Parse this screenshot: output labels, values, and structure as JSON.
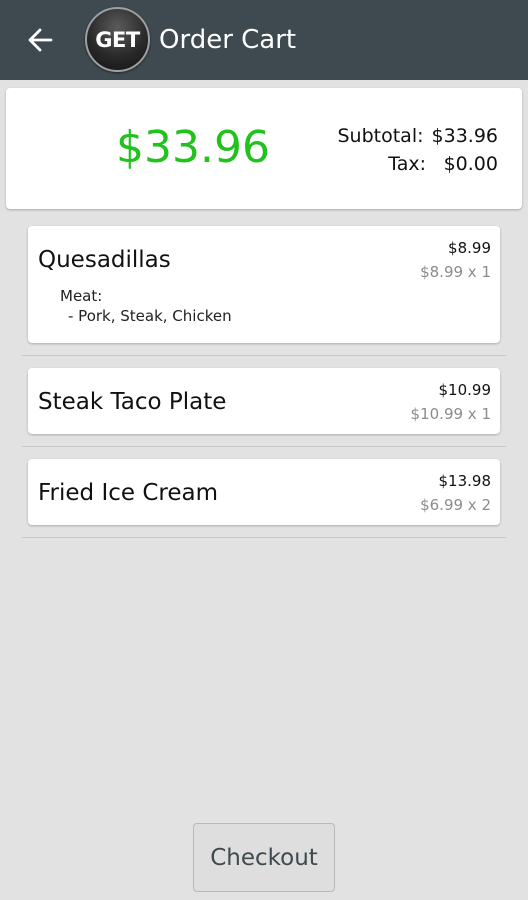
{
  "appbar": {
    "back_icon": "arrow-left-icon",
    "logo_text": "GET",
    "title": "Order Cart"
  },
  "summary": {
    "total": "$33.96",
    "subtotal_label": "Subtotal:",
    "subtotal_value": "$33.96",
    "tax_label": "Tax:",
    "tax_value": "$0.00",
    "total_color": "#22c21e"
  },
  "items": [
    {
      "name": "Quesadillas",
      "price": "$8.99",
      "unit": "$8.99 x 1",
      "modifier_label": "Meat:",
      "modifier_value": "- Pork, Steak, Chicken"
    },
    {
      "name": "Steak Taco Plate",
      "price": "$10.99",
      "unit": "$10.99 x 1"
    },
    {
      "name": "Fried Ice Cream",
      "price": "$13.98",
      "unit": "$6.99 x 2"
    }
  ],
  "checkout_label": "Checkout",
  "colors": {
    "appbar": "#3e4a50",
    "background": "#e2e2e2"
  }
}
